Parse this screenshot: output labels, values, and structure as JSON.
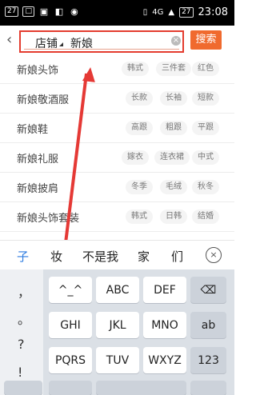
{
  "status": {
    "left_badges": [
      "27",
      "□"
    ],
    "icons": [
      "image-icon",
      "bag-icon",
      "wifi-icon",
      "vibrate-icon",
      "network-icon",
      "battery-icon"
    ],
    "network": "4G",
    "battery": "27",
    "time": "23:08"
  },
  "search": {
    "scope": "店铺",
    "query": "新娘",
    "button": "搜索"
  },
  "list": [
    {
      "title": "新娘头饰",
      "tags": [
        "韩式",
        "三件套",
        "红色"
      ]
    },
    {
      "title": "新娘敬酒服",
      "tags": [
        "长款",
        "长袖",
        "短款"
      ]
    },
    {
      "title": "新娘鞋",
      "tags": [
        "高跟",
        "粗跟",
        "平跟"
      ]
    },
    {
      "title": "新娘礼服",
      "tags": [
        "嫁衣",
        "连衣裙",
        "中式"
      ]
    },
    {
      "title": "新娘披肩",
      "tags": [
        "冬季",
        "毛绒",
        "秋冬"
      ]
    },
    {
      "title": "新娘头饰套装",
      "tags": [
        "韩式",
        "日韩",
        "结婚"
      ]
    }
  ],
  "candidates": [
    "子",
    "妆",
    "不是我",
    "家",
    "们"
  ],
  "keyboard": {
    "side": [
      "，",
      "。",
      "?",
      "!"
    ],
    "row1": [
      "^_^",
      "ABC",
      "DEF"
    ],
    "row2": [
      "GHI",
      "JKL",
      "MNO",
      "ab"
    ],
    "row3": [
      "PQRS",
      "TUV",
      "WXYZ",
      "123"
    ]
  },
  "colors": {
    "accent": "#f06a2e",
    "highlight": "#e53935",
    "candidate": "#2f7de1"
  }
}
